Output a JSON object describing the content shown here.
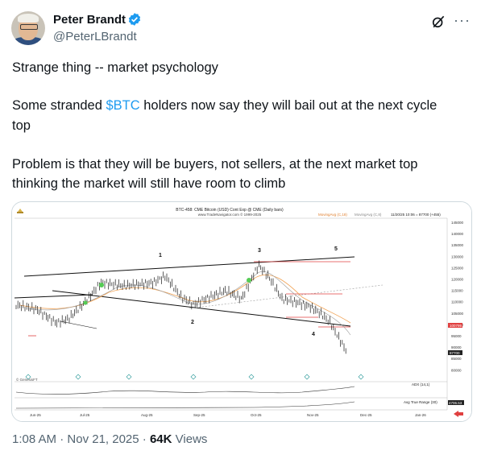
{
  "author": {
    "name": "Peter Brandt",
    "handle": "@PeterLBrandt",
    "verified_icon": "verified-badge-icon",
    "avatar_icon": "avatar-image"
  },
  "actions": {
    "grok_icon": "grok-icon",
    "more_icon": "more-options-icon",
    "more_label": "···"
  },
  "tweet": {
    "line1": "Strange thing -- market psychology",
    "line2_pre": "Some stranded ",
    "cashtag": "$BTC",
    "line2_post": " holders now say they will bail out at the next cycle",
    "line3": "top",
    "line4": "Problem is that they will be buyers, not sellers, at the next market top",
    "line5": "thinking the market will still have room to climb"
  },
  "chart_image": {
    "title": "BTC-458: CME Bitcoin (USD) Cont Exp @ CME (Daily bars)",
    "subtitle": "www.TradeNavigator.com © 1999-2025",
    "legend_ma1": "MovingAvg (C,18)",
    "legend_ma2": "MovingAvg (C,8)",
    "legend_quote": "11/20/25 10:06 = 87700 (+455)",
    "watermark": "© GenesisFT",
    "adx_label": "ADX (14,1)",
    "atr_label": "Avg True Range (30)",
    "x_ticks": [
      "Jun-25",
      "Jul-25",
      "Aug-25",
      "Sep-25",
      "Oct-25",
      "Nov-25",
      "Dec-25",
      "Jan-26"
    ],
    "y_ticks": [
      "145000",
      "140000",
      "135000",
      "130000",
      "125000",
      "120000",
      "115000",
      "110000",
      "105000",
      "100000",
      "95000",
      "90000",
      "85000",
      "80000"
    ],
    "price_flag_1": "100795",
    "price_flag_2": "87700",
    "atr_value": "4706.53",
    "wave_labels": [
      "1",
      "2",
      "3",
      "4",
      "5"
    ],
    "colors": {
      "bars": "#1a1a1a",
      "ma_fast": "#f0a050",
      "ma_slow": "#9a9a9a",
      "resistance": "#e04040",
      "trend": "#111111",
      "signal": "#55cc55"
    }
  },
  "footer": {
    "time": "1:08 AM",
    "sep": " · ",
    "date": "Nov 21, 2025",
    "sep2": " · ",
    "views": "64K",
    "views_label": " Views"
  }
}
